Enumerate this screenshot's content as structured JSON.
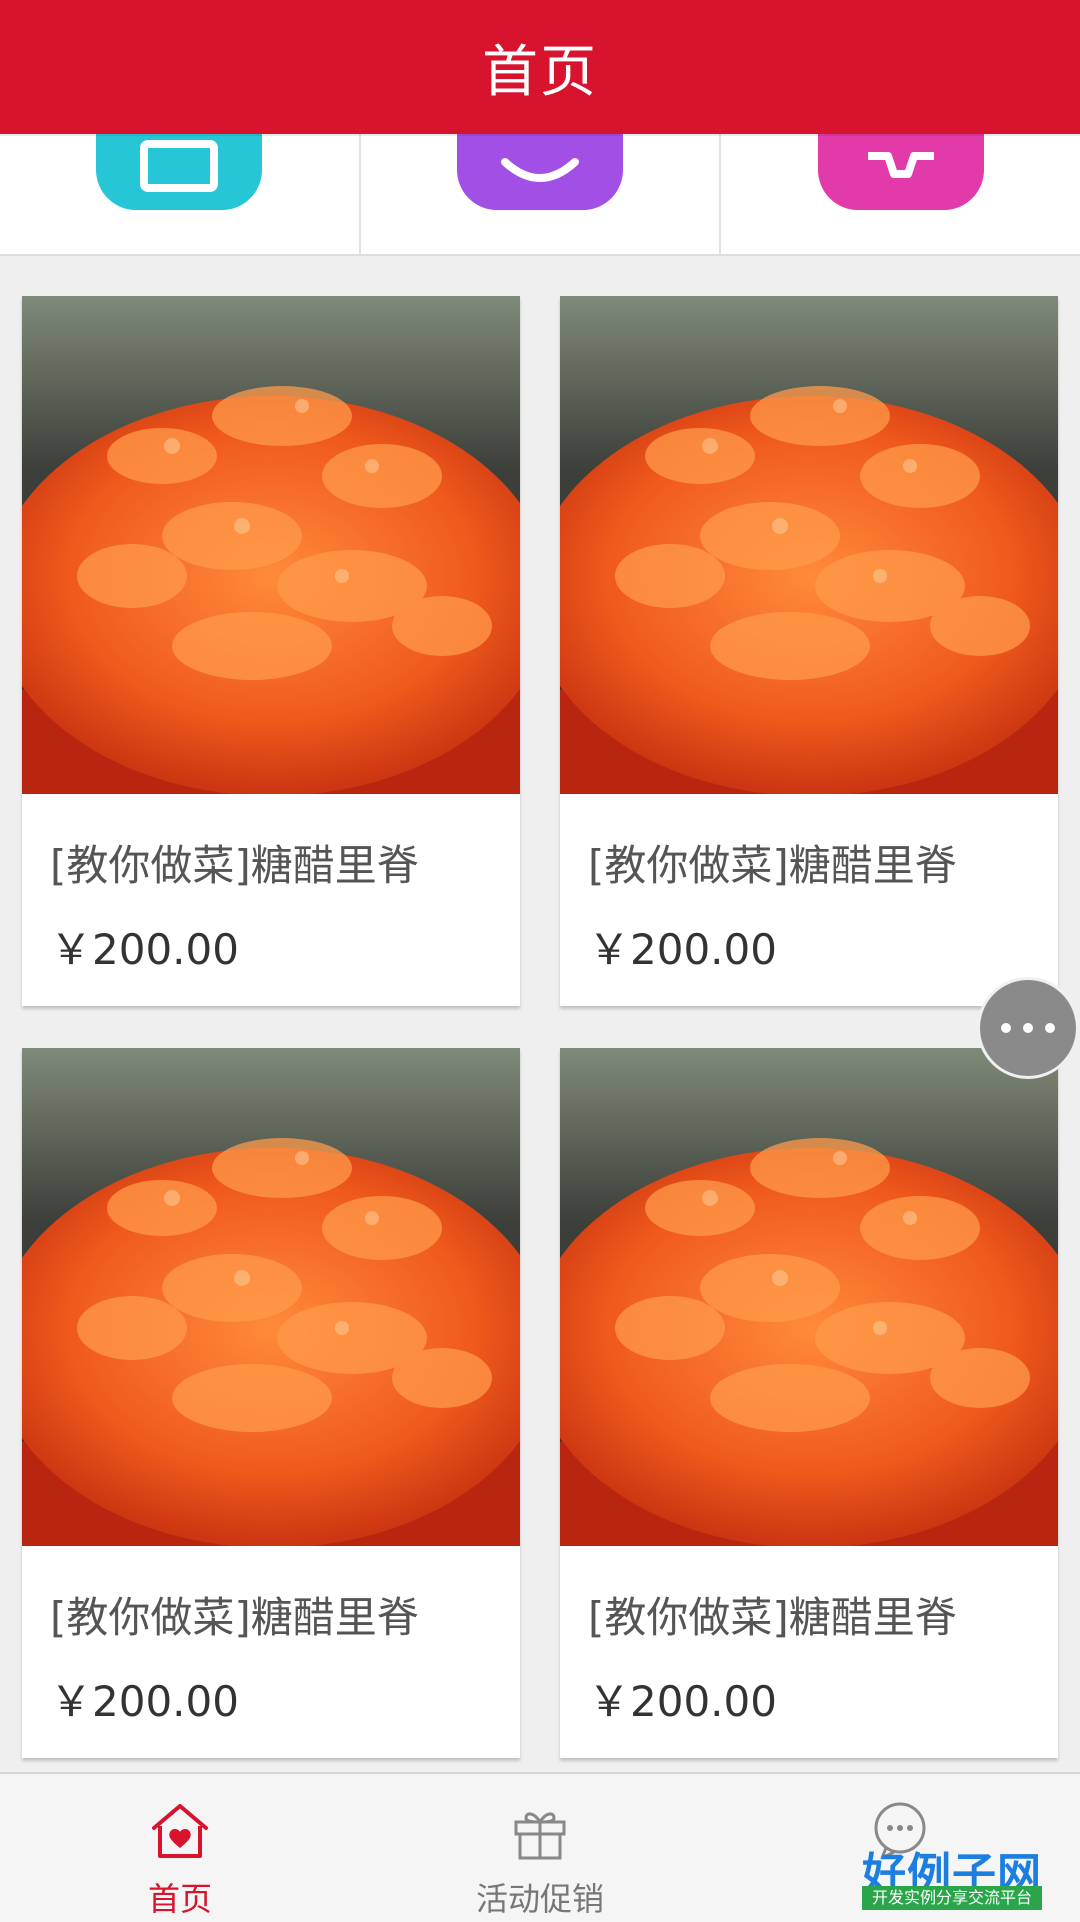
{
  "header": {
    "title": "首页"
  },
  "categories": [
    {
      "icon": "monitor-icon",
      "color": "#26c6d6"
    },
    {
      "icon": "chat-icon",
      "color": "#a24fe6"
    },
    {
      "icon": "figure-icon",
      "color": "#e23aa8"
    }
  ],
  "products": [
    {
      "title": "[教你做菜]糖醋里脊",
      "price": "￥200.00"
    },
    {
      "title": "[教你做菜]糖醋里脊",
      "price": "￥200.00"
    },
    {
      "title": "[教你做菜]糖醋里脊",
      "price": "￥200.00"
    },
    {
      "title": "[教你做菜]糖醋里脊",
      "price": "￥200.00"
    }
  ],
  "tabs": [
    {
      "label": "首页",
      "icon": "home-heart-icon",
      "active": true
    },
    {
      "label": "活动促销",
      "icon": "gift-icon",
      "active": false
    },
    {
      "label": "",
      "icon": "chat-bubble-icon",
      "active": false
    }
  ],
  "brand": {
    "title": "好例子网",
    "subtitle": "开发实例分享交流平台"
  },
  "colors": {
    "primary": "#d8132d",
    "accent_blue": "#1b7ee0",
    "accent_green": "#2aa54a"
  }
}
